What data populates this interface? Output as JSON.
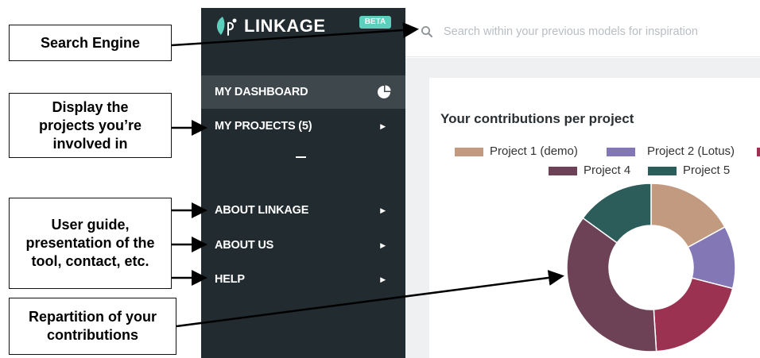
{
  "app": {
    "name": "LINKAGE",
    "badge": "BETA"
  },
  "search": {
    "placeholder": "Search within your previous models for inspiration"
  },
  "sidebar": {
    "items": [
      {
        "label": "MY DASHBOARD",
        "icon": "pie-chart-icon",
        "active": true
      },
      {
        "label": "MY PROJECTS (5)",
        "icon": "chevron-right-icon"
      },
      {
        "label": "ABOUT LINKAGE",
        "icon": "chevron-right-icon"
      },
      {
        "label": "ABOUT US",
        "icon": "chevron-right-icon"
      },
      {
        "label": "HELP",
        "icon": "chevron-right-icon"
      }
    ]
  },
  "main": {
    "title": "Your contributions per project",
    "legend": [
      {
        "label": "Project 1 (demo)",
        "color": "#c19a7f"
      },
      {
        "label": "Project 2 (Lotus)",
        "color": "#8377b6"
      },
      {
        "label": "Project 4",
        "color": "#6d4257"
      },
      {
        "label": "Project 5",
        "color": "#2d5d5a"
      }
    ]
  },
  "chart_data": {
    "type": "pie",
    "donut": true,
    "title": "Your contributions per project",
    "series": [
      {
        "name": "Project 1 (demo)",
        "value": 17,
        "color": "#c19a7f"
      },
      {
        "name": "Project 2 (Lotus)",
        "value": 12,
        "color": "#8377b6"
      },
      {
        "name": "",
        "value": 20,
        "color": "#9b3252"
      },
      {
        "name": "Project 4",
        "value": 36,
        "color": "#6d4257"
      },
      {
        "name": "Project 5",
        "value": 15,
        "color": "#2d5d5a"
      }
    ],
    "legend_position": "top"
  },
  "callouts": {
    "search": "Search Engine",
    "projects": [
      "Display the",
      "projects you’re",
      "involved in"
    ],
    "guide": [
      "User guide,",
      "presentation of the",
      "tool, contact, etc."
    ],
    "repartition": [
      "Repartition of your",
      "contributions"
    ]
  },
  "colors": {
    "sidebar": "#222b30",
    "sidebar_active": "#3d474c",
    "accent": "#5dcfbd"
  }
}
